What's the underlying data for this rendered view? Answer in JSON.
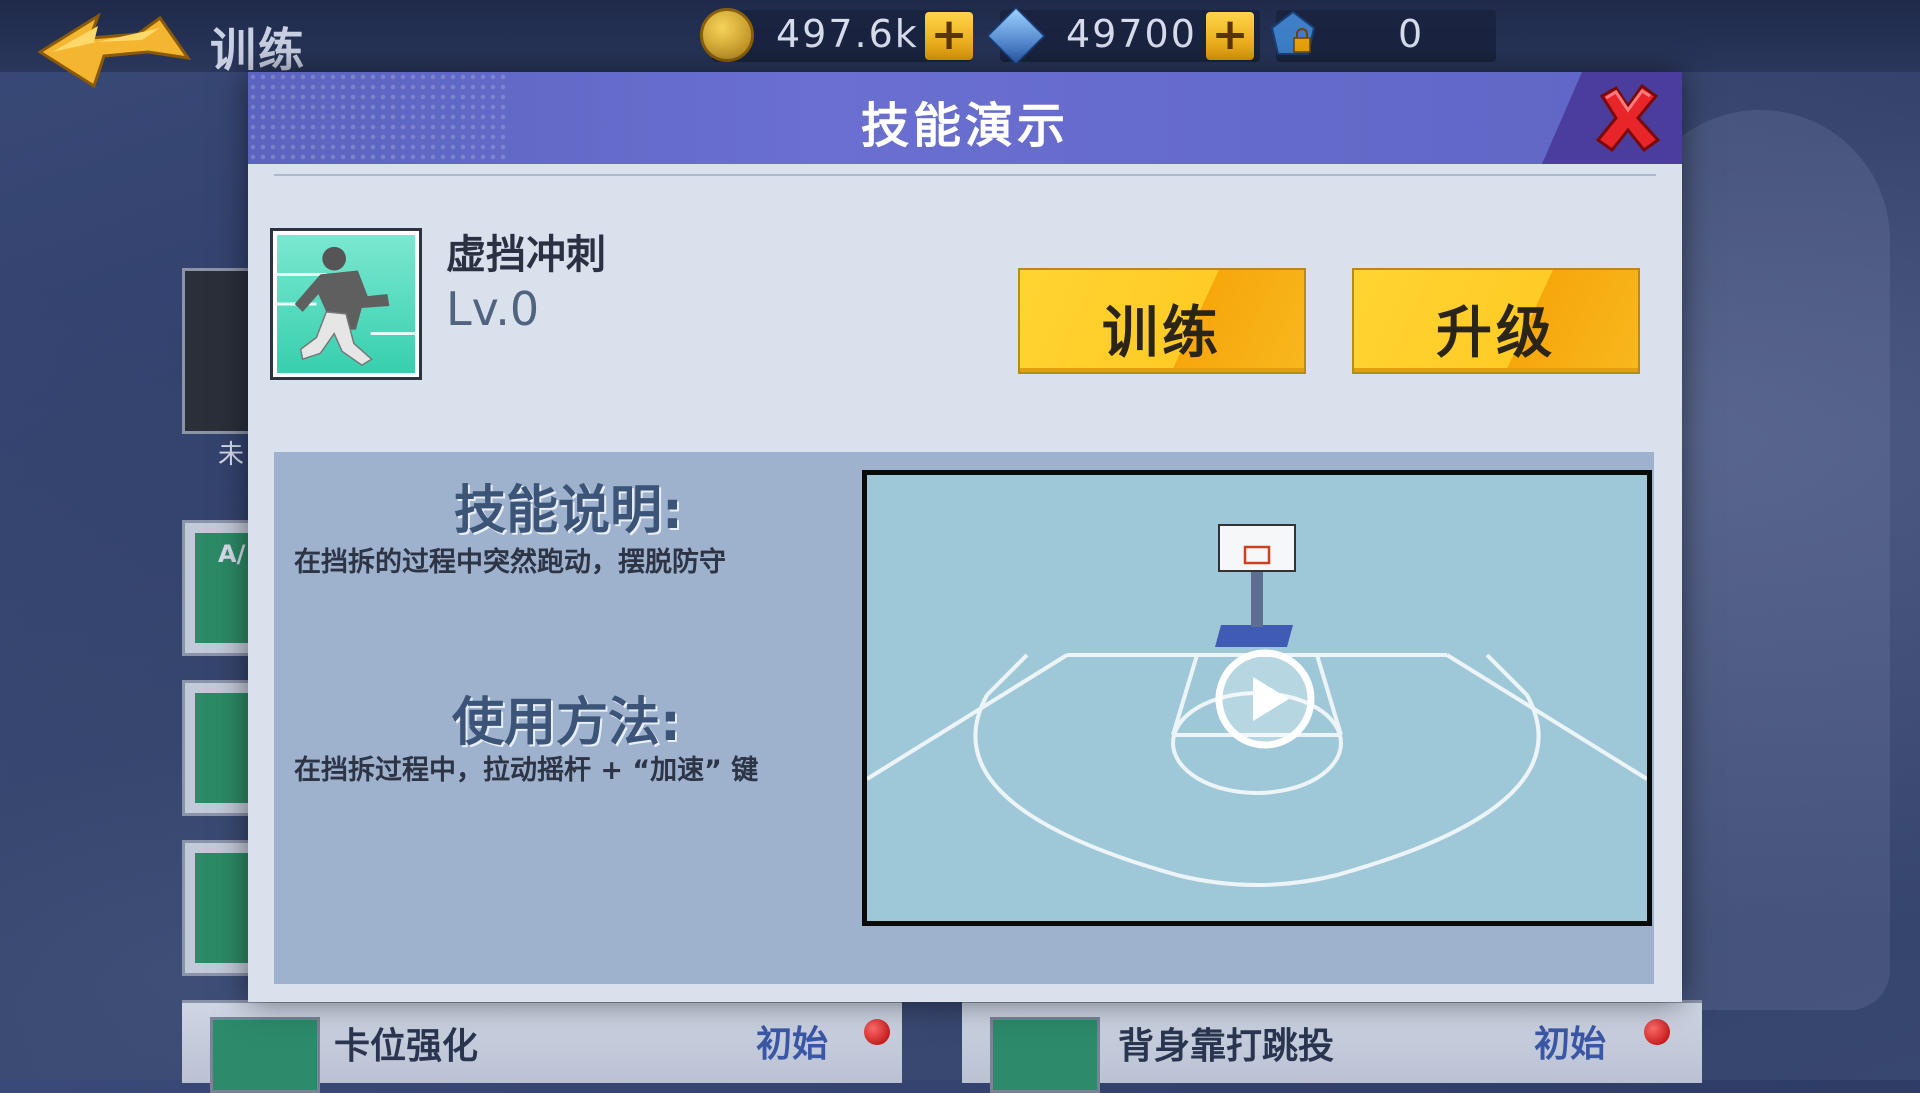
{
  "topbar": {
    "title": "训练",
    "coins": "497.6k",
    "gems": "49700",
    "locked_gems": "0"
  },
  "background": {
    "side_card_label": "未",
    "side_card_text": "A/",
    "bottom_cards": [
      {
        "name": "卡位强化",
        "state": "初始"
      },
      {
        "name": "背身靠打跳投",
        "state": "初始"
      }
    ]
  },
  "modal": {
    "title": "技能演示",
    "skill": {
      "name": "虚挡冲刺",
      "level": "Lv.0"
    },
    "buttons": {
      "train": "训练",
      "upgrade": "升级"
    },
    "description": {
      "heading": "技能说明:",
      "text": "在挡拆的过程中突然跑动，摆脱防守"
    },
    "usage": {
      "heading": "使用方法:",
      "text": "在挡拆过程中，拉动摇杆 + “加速” 键"
    }
  },
  "colors": {
    "header": "#5b64bf",
    "button_yellow": "#ffcb26",
    "close_red": "#e8262a",
    "court": "#9ec8d8"
  }
}
